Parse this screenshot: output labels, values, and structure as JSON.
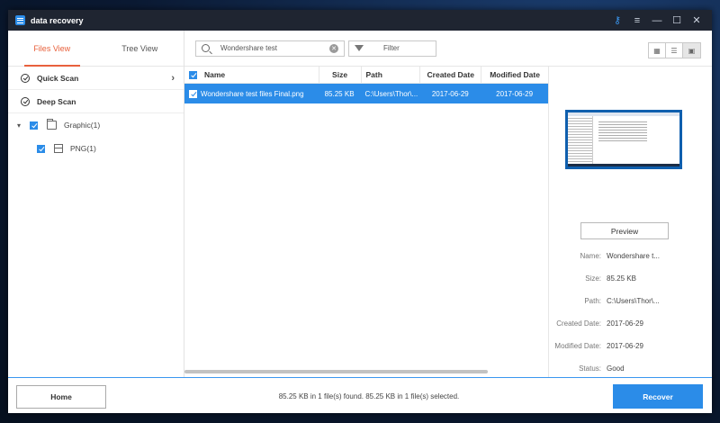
{
  "app": {
    "title": "data recovery"
  },
  "titlebar_icons": [
    "key-icon",
    "menu-icon",
    "minimize-icon",
    "maximize-icon",
    "close-icon"
  ],
  "tabs": [
    {
      "label": "Files View",
      "active": true
    },
    {
      "label": "Tree View",
      "active": false
    }
  ],
  "scans": [
    {
      "label": "Quick Scan"
    },
    {
      "label": "Deep Scan"
    }
  ],
  "tree": [
    {
      "label": "Graphic(1)",
      "checked": true,
      "level": 1,
      "icon": "folder-icon"
    },
    {
      "label": "PNG(1)",
      "checked": true,
      "level": 2,
      "icon": "file-type-icon"
    }
  ],
  "search": {
    "value": "Wondershare test"
  },
  "filter": {
    "label": "Filter"
  },
  "view_modes": [
    "grid-view-icon",
    "list-view-icon",
    "preview-view-icon"
  ],
  "table": {
    "headers": [
      "Name",
      "Size",
      "Path",
      "Created Date",
      "Modified Date"
    ],
    "rows": [
      {
        "name": "Wondershare test files Final.png",
        "size": "85.25 KB",
        "path": "C:\\Users\\Thor\\...",
        "created": "2017-06-29",
        "modified": "2017-06-29",
        "selected": true
      }
    ]
  },
  "preview": {
    "button_label": "Preview",
    "fields": [
      {
        "key": "Name:",
        "value": "Wondershare t..."
      },
      {
        "key": "Size:",
        "value": "85.25 KB"
      },
      {
        "key": "Path:",
        "value": "C:\\Users\\Thor\\..."
      },
      {
        "key": "Created Date:",
        "value": "2017-06-29"
      },
      {
        "key": "Modified Date:",
        "value": "2017-06-29"
      },
      {
        "key": "Status:",
        "value": "Good"
      }
    ]
  },
  "footer": {
    "home_label": "Home",
    "status_text": "85.25 KB in 1 file(s) found.   85.25 KB in 1 file(s) selected.",
    "recover_label": "Recover"
  },
  "colors": {
    "accent": "#2b8ce8",
    "tab_active": "#e8613c",
    "titlebar": "#1f2531"
  }
}
